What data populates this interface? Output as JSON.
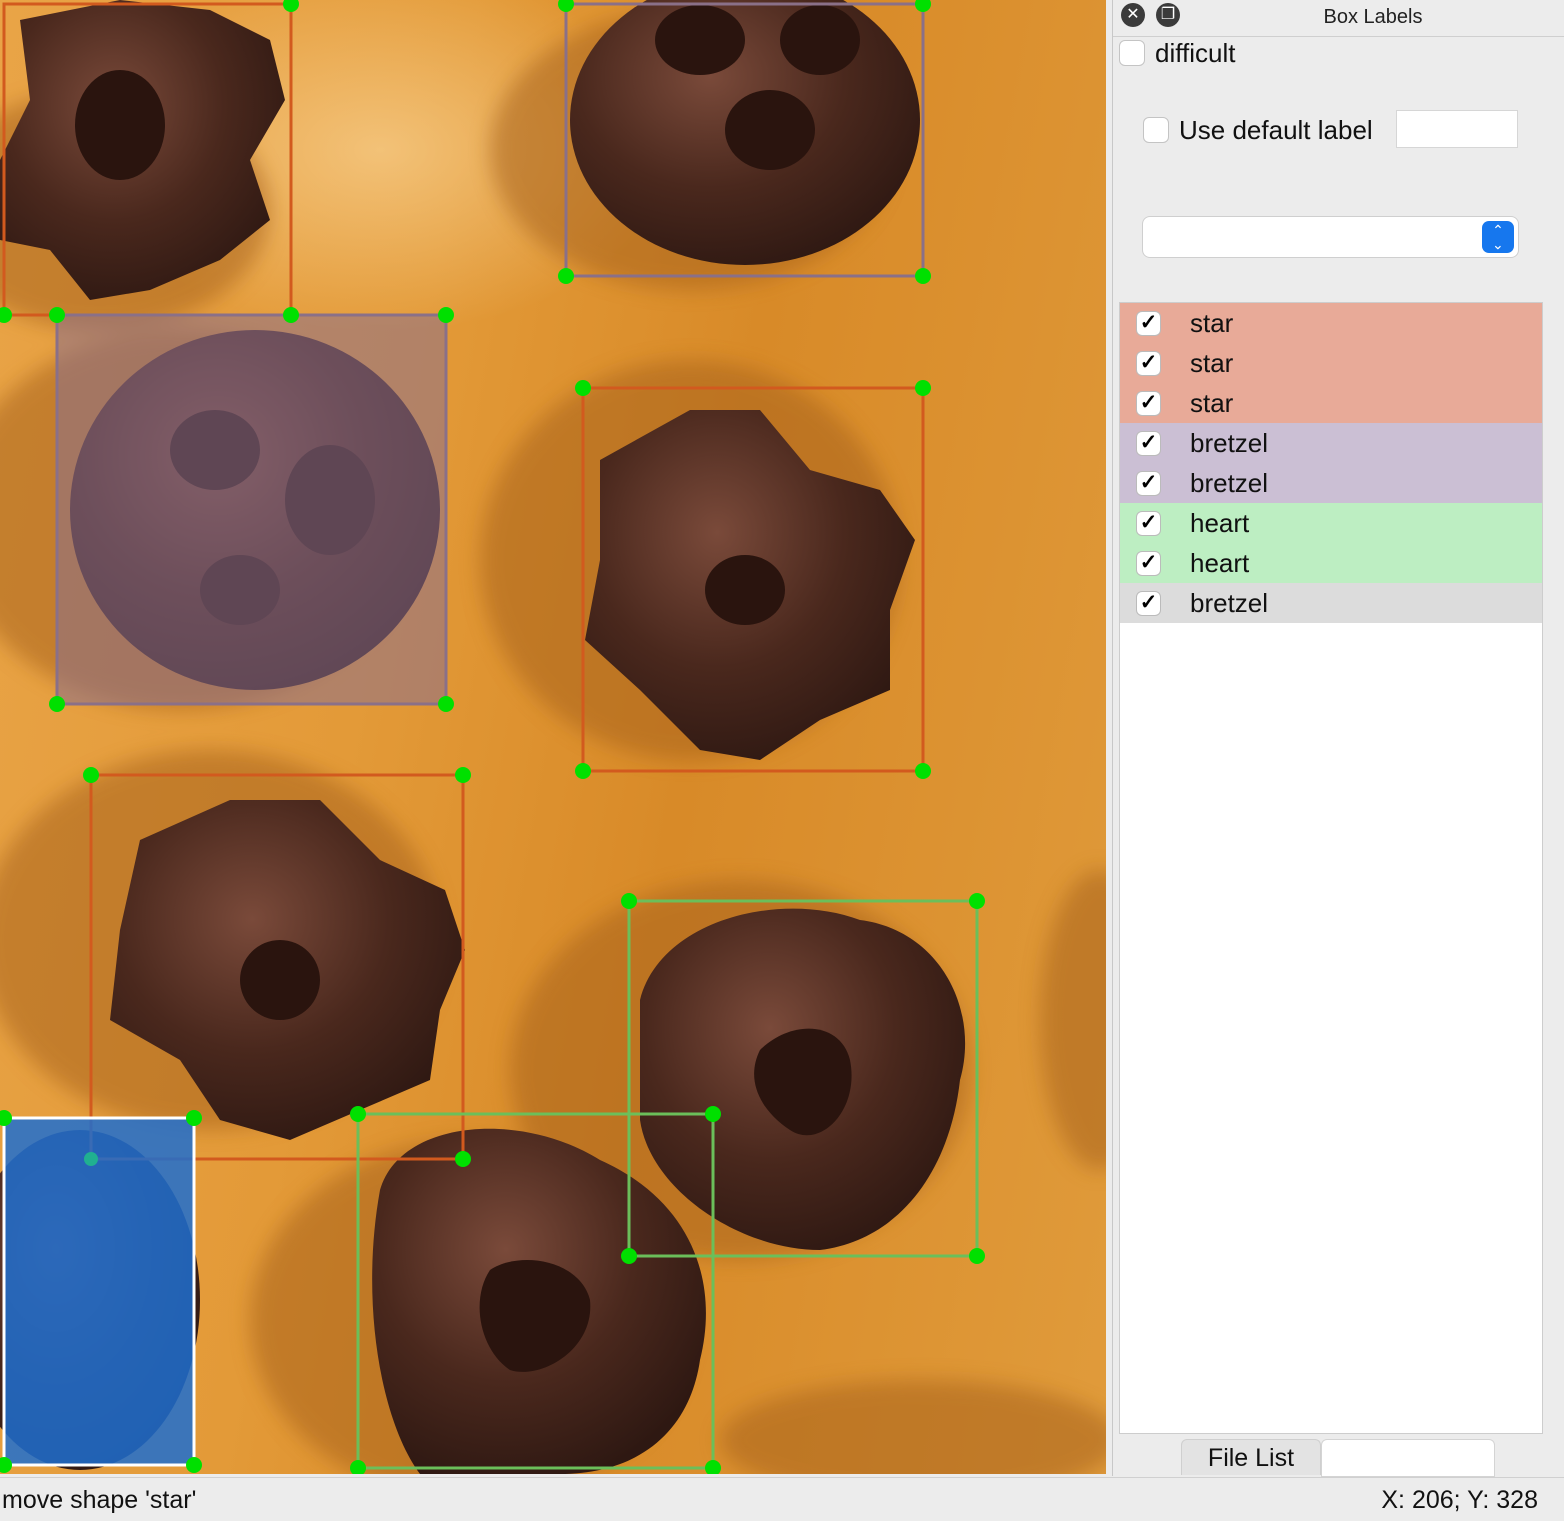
{
  "dock": {
    "title": "Box Labels",
    "difficult_label": "difficult",
    "difficult_checked": false,
    "use_default_label": "Use default label",
    "use_default_checked": false,
    "default_label_value": "",
    "label_combo_value": ""
  },
  "label_list": [
    {
      "label": "star",
      "checked": true,
      "color": "#e8aa98"
    },
    {
      "label": "star",
      "checked": true,
      "color": "#e8aa98"
    },
    {
      "label": "star",
      "checked": true,
      "color": "#e8aa98"
    },
    {
      "label": "bretzel",
      "checked": true,
      "color": "#cbbfd4"
    },
    {
      "label": "bretzel",
      "checked": true,
      "color": "#cbbfd4"
    },
    {
      "label": "heart",
      "checked": true,
      "color": "#bdeec2"
    },
    {
      "label": "heart",
      "checked": true,
      "color": "#bdeec2"
    },
    {
      "label": "bretzel",
      "checked": true,
      "color": "#dcdcdc"
    }
  ],
  "bottom_tabs": {
    "file_list": "File List"
  },
  "status": {
    "message": "move shape 'star'",
    "coords": "X: 206; Y: 328"
  },
  "colors": {
    "star_box": "#d25a1e",
    "bretzel_box": "#8a7088",
    "heart_box": "#6bbf5a",
    "selected_fill": "#1e6fd0",
    "handle": "#00e000"
  },
  "icons": {
    "close": "close-icon",
    "float": "float-icon",
    "combo_arrow": "chevron-updown-icon",
    "check": "checkmark-icon"
  }
}
